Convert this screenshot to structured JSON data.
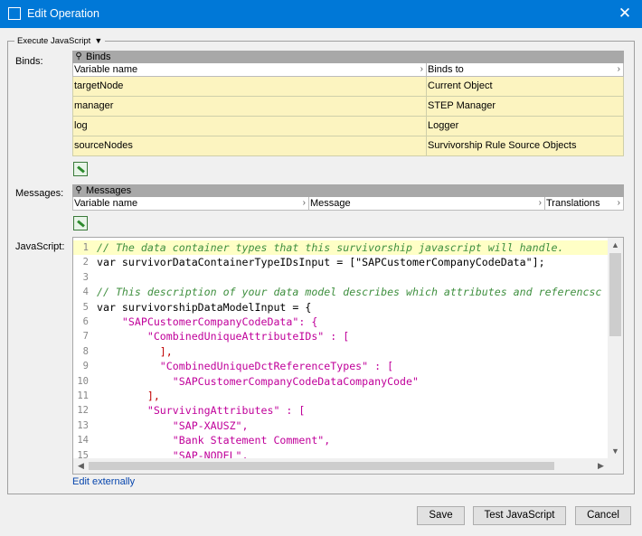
{
  "window": {
    "title": "Edit Operation"
  },
  "group": {
    "legend": "Execute JavaScript"
  },
  "binds": {
    "label": "Binds:",
    "header": "Binds",
    "columns": [
      "Variable name",
      "Binds to"
    ],
    "rows": [
      [
        "targetNode",
        "Current Object"
      ],
      [
        "manager",
        "STEP Manager"
      ],
      [
        "log",
        "Logger"
      ],
      [
        "sourceNodes",
        "Survivorship Rule Source Objects"
      ]
    ]
  },
  "messages": {
    "label": "Messages:",
    "header": "Messages",
    "columns": [
      "Variable name",
      "Message",
      "Translations"
    ]
  },
  "javascript": {
    "label": "JavaScript:",
    "line_numbers": [
      "1",
      "2",
      "3",
      "4",
      "5",
      "6",
      "7",
      "8",
      "9",
      "10",
      "11",
      "12",
      "13",
      "14",
      "15"
    ],
    "lines": [
      "// The data container types that this survivorship javascript will handle.",
      "var survivorDataContainerTypeIDsInput = [\"SAPCustomerCompanyCodeData\"];",
      "",
      "// This description of your data model describes which attributes and referencsc",
      "var survivorshipDataModelInput = {",
      "    \"SAPCustomerCompanyCodeData\": {",
      "        \"CombinedUniqueAttributeIDs\" : [",
      "          ],",
      "          \"CombinedUniqueDctReferenceTypes\" : [",
      "            \"SAPCustomerCompanyCodeDataCompanyCode\"",
      "        ],",
      "        \"SurvivingAttributes\" : [",
      "            \"SAP-XAUSZ\",",
      "            \"Bank Statement Comment\",",
      "            \"SAP-NODEL\","
    ],
    "edit_link": "Edit externally"
  },
  "buttons": {
    "save": "Save",
    "test": "Test JavaScript",
    "cancel": "Cancel"
  },
  "colors": {
    "titlebar": "#0078d7",
    "row_bg": "#fcf4c0",
    "comment": "#3f8f3f",
    "string": "#c0009a",
    "keyword": "#000080"
  }
}
